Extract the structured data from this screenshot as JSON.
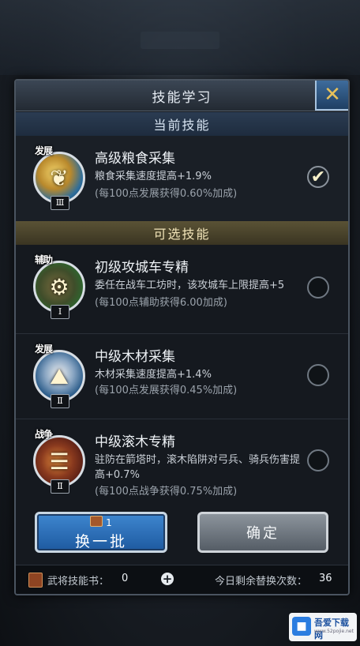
{
  "dialog": {
    "title": "技能学习",
    "close_icon": "close-x-icon"
  },
  "current": {
    "header": "当前技能",
    "skill": {
      "type_tag": "发展",
      "tier": "Ⅲ",
      "name": "高级粮食采集",
      "desc": "粮食采集速度提高+1.9%",
      "note": "(每100点发展获得0.60%加成)",
      "selected": true,
      "icon": "wheat-icon"
    }
  },
  "optional": {
    "header": "可选技能",
    "skills": [
      {
        "type_tag": "辅助",
        "tier": "Ⅰ",
        "name": "初级攻城车专精",
        "desc": "委任在战车工坊时，该攻城车上限提高+5",
        "note": "(每100点辅助获得6.00加成)",
        "icon": "siege-cart-icon"
      },
      {
        "type_tag": "发展",
        "tier": "Ⅱ",
        "name": "中级木材采集",
        "desc": "木材采集速度提高+1.4%",
        "note": "(每100点发展获得0.45%加成)",
        "icon": "wood-icon"
      },
      {
        "type_tag": "战争",
        "tier": "Ⅱ",
        "name": "中级滚木专精",
        "desc": "驻防在箭塔时，滚木陷阱对弓兵、骑兵伤害提高+0.7%",
        "note": "(每100点战争获得0.75%加成)",
        "icon": "log-trap-icon"
      }
    ]
  },
  "buttons": {
    "refresh_cost": "1",
    "refresh_label": "换一批",
    "confirm_label": "确定"
  },
  "footer": {
    "book_label": "武将技能书：",
    "book_count": "0",
    "add_symbol": "+",
    "remaining_label": "今日剩余替换次数：",
    "remaining_count": "36"
  },
  "watermark": {
    "title": "吾爱下载网",
    "subtitle": "www.52pojie.net"
  }
}
